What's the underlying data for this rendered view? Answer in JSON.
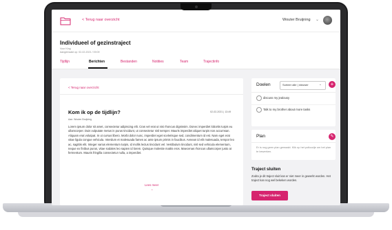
{
  "header": {
    "back_label": "< Terug naar overzicht",
    "user_name": "Wouter Bruijning",
    "user_chevron": "⌄"
  },
  "page": {
    "title": "Individueel of gezinstraject",
    "subtitle_line1": "Voor King",
    "subtitle_line2": "Aangemaakt op: 02-02-2021 / 09:09"
  },
  "tabs": [
    "Tijdlijn",
    "Berichten",
    "Bestanden",
    "Notities",
    "Team",
    "Trajectinfo"
  ],
  "active_tab": "Berichten",
  "message": {
    "back_label": "< Terug naar overzicht",
    "title": "Kom ik op de tijdlijn?",
    "date": "02-02-2021 | 13:49",
    "to": "Aan: Wouter Bruijning",
    "body": "Lorem ipsum dolor sit amet, consectetur adipiscing elit. Cras vel erat ut nisi rhoncus dignissim. Donec imperdiet lobortis turpis eu ullamcorper. Duis vulputate metus in purus tincidunt, ut consectetur nisl semper. Mauris imperdiet aliquet turpis non accumsan. Aliquam erat volutpat. In ut cursus libero. Morbi dolor nunc, imperdiet eget scelerisque sed, condimentum id est. Nam eget erat vitae ligula congue vehicula. Interdum et malesuada fames ac ante ipsum primis in faucibus. Aenean id elit malesuada, tempor leo ac, sagittis elit. Integer varius elementum turpis, id mollis lectus tincidunt vel. Vestibulum tincidunt, nisl sed vehicula elementum, neque ex finibus purus, vitae sodales leo sapien id lorem. Quisque molestie mattis eros. Maecenas rhoncus ullamcorper justo at fermentum. Mauris fringilla consectetur nulla, a imperdiet.",
    "read_more": "Lees meer",
    "read_more_chevron": "⌄"
  },
  "goals": {
    "title": "Doelen",
    "sort_label": "Sorteer alle | nieuwer",
    "sort_chevron": "⌄",
    "add_symbol": "+",
    "items": [
      "discuss my jealousy",
      "Talk to my brother about more tasks"
    ]
  },
  "plan": {
    "title": "Plan",
    "edit_symbol": "✎",
    "empty_text": "Er is nog geen plan gemaakt. Klik op het potloodje om het plan te bewerken."
  },
  "close": {
    "title": "Traject sluiten",
    "text": "Zodra je dit traject sluit kan er niet meer in gewerkt worden. Het traject kan nog wel bekeken worden.",
    "button": "Traject sluiten"
  },
  "colors": {
    "accent": "#d6246e",
    "background": "#f2f2f4"
  }
}
